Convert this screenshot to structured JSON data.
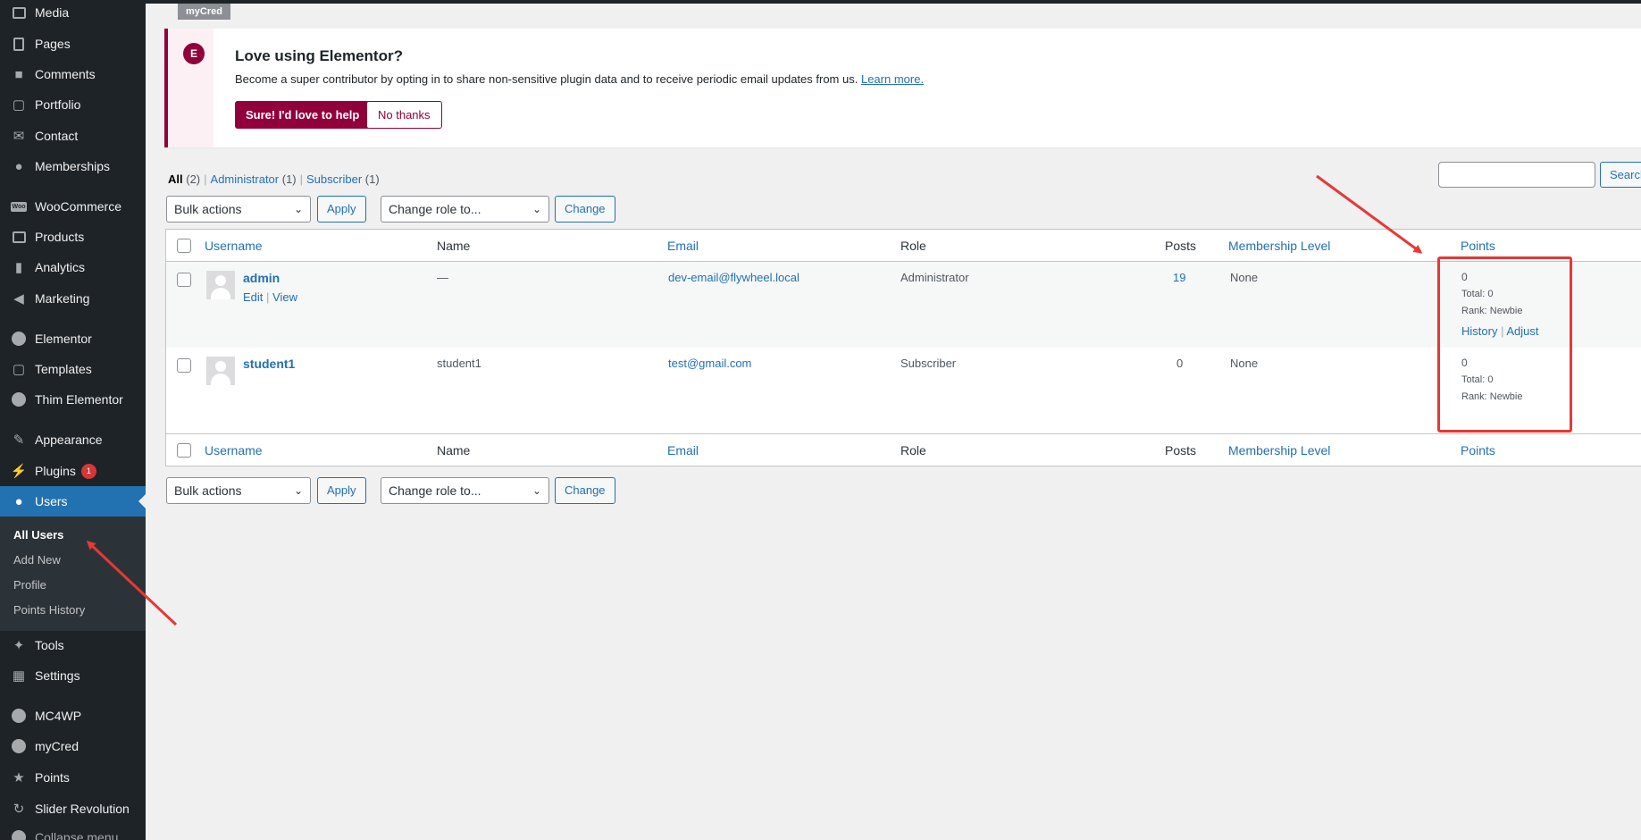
{
  "sidebar": {
    "items": [
      {
        "label": "Media",
        "icon": "media-icon"
      },
      {
        "label": "Pages",
        "icon": "pages-icon"
      },
      {
        "label": "Comments",
        "icon": "comments-icon"
      },
      {
        "label": "Portfolio",
        "icon": "folder-icon"
      },
      {
        "label": "Contact",
        "icon": "envelope-icon"
      },
      {
        "label": "Memberships",
        "icon": "groups-icon"
      },
      {
        "label": "WooCommerce",
        "icon": "woocommerce-icon"
      },
      {
        "label": "Products",
        "icon": "archive-icon"
      },
      {
        "label": "Analytics",
        "icon": "bar-chart-icon"
      },
      {
        "label": "Marketing",
        "icon": "megaphone-icon"
      },
      {
        "label": "Elementor",
        "icon": "elementor-icon"
      },
      {
        "label": "Templates",
        "icon": "folder-icon"
      },
      {
        "label": "Thim Elementor",
        "icon": "thim-icon"
      },
      {
        "label": "Appearance",
        "icon": "paintbrush-icon"
      },
      {
        "label": "Plugins",
        "icon": "plugin-icon",
        "badge": "1"
      },
      {
        "label": "Users",
        "icon": "user-icon",
        "active": true
      },
      {
        "label": "Tools",
        "icon": "wrench-icon"
      },
      {
        "label": "Settings",
        "icon": "settings-icon"
      },
      {
        "label": "MC4WP",
        "icon": "mc4wp-icon"
      },
      {
        "label": "myCred",
        "icon": "mycred-icon"
      },
      {
        "label": "Points",
        "icon": "star-icon"
      },
      {
        "label": "Slider Revolution",
        "icon": "refresh-icon"
      },
      {
        "label": "Collapse menu",
        "icon": "collapse-icon"
      }
    ],
    "submenu": [
      "All Users",
      "Add New",
      "Profile",
      "Points History"
    ]
  },
  "topbar": {
    "tag": "myCred"
  },
  "notice": {
    "logo": "E",
    "title": "Love using Elementor?",
    "text": "Become a super contributor by opting in to share non-sensitive plugin data and to receive periodic email updates from us.",
    "link": "Learn more.",
    "yes_button": "Sure! I'd love to help",
    "no_button": "No thanks"
  },
  "filters": {
    "all": "All",
    "all_count": "(2)",
    "administrator": "Administrator",
    "administrator_count": "(1)",
    "subscriber": "Subscriber",
    "subscriber_count": "(1)",
    "separator": "|"
  },
  "search": {
    "button": "Search Users"
  },
  "actions": {
    "bulk": "Bulk actions",
    "apply": "Apply",
    "change_role": "Change role to...",
    "change": "Change"
  },
  "table": {
    "columns": {
      "username": "Username",
      "name": "Name",
      "email": "Email",
      "role": "Role",
      "posts": "Posts",
      "membership": "Membership Level",
      "points": "Points"
    },
    "rows": [
      {
        "username": "admin",
        "name": "—",
        "email": "dev-email@flywheel.local",
        "role": "Administrator",
        "posts": "19",
        "membership": "None",
        "points": "0",
        "total": "Total: 0",
        "rank": "Rank: Newbie",
        "actions": {
          "edit": "Edit",
          "view": "View",
          "sep": "|"
        },
        "points_actions": {
          "history": "History",
          "adjust": "Adjust",
          "sep": "|"
        }
      },
      {
        "username": "student1",
        "name": "student1",
        "email": "test@gmail.com",
        "role": "Subscriber",
        "posts": "0",
        "membership": "None",
        "points": "0",
        "total": "Total: 0",
        "rank": "Rank: Newbie"
      }
    ]
  },
  "colors": {
    "sidebar_bg": "#1d2327",
    "accent": "#2271b1",
    "elementor": "#92003b",
    "annotation": "#e53935"
  }
}
